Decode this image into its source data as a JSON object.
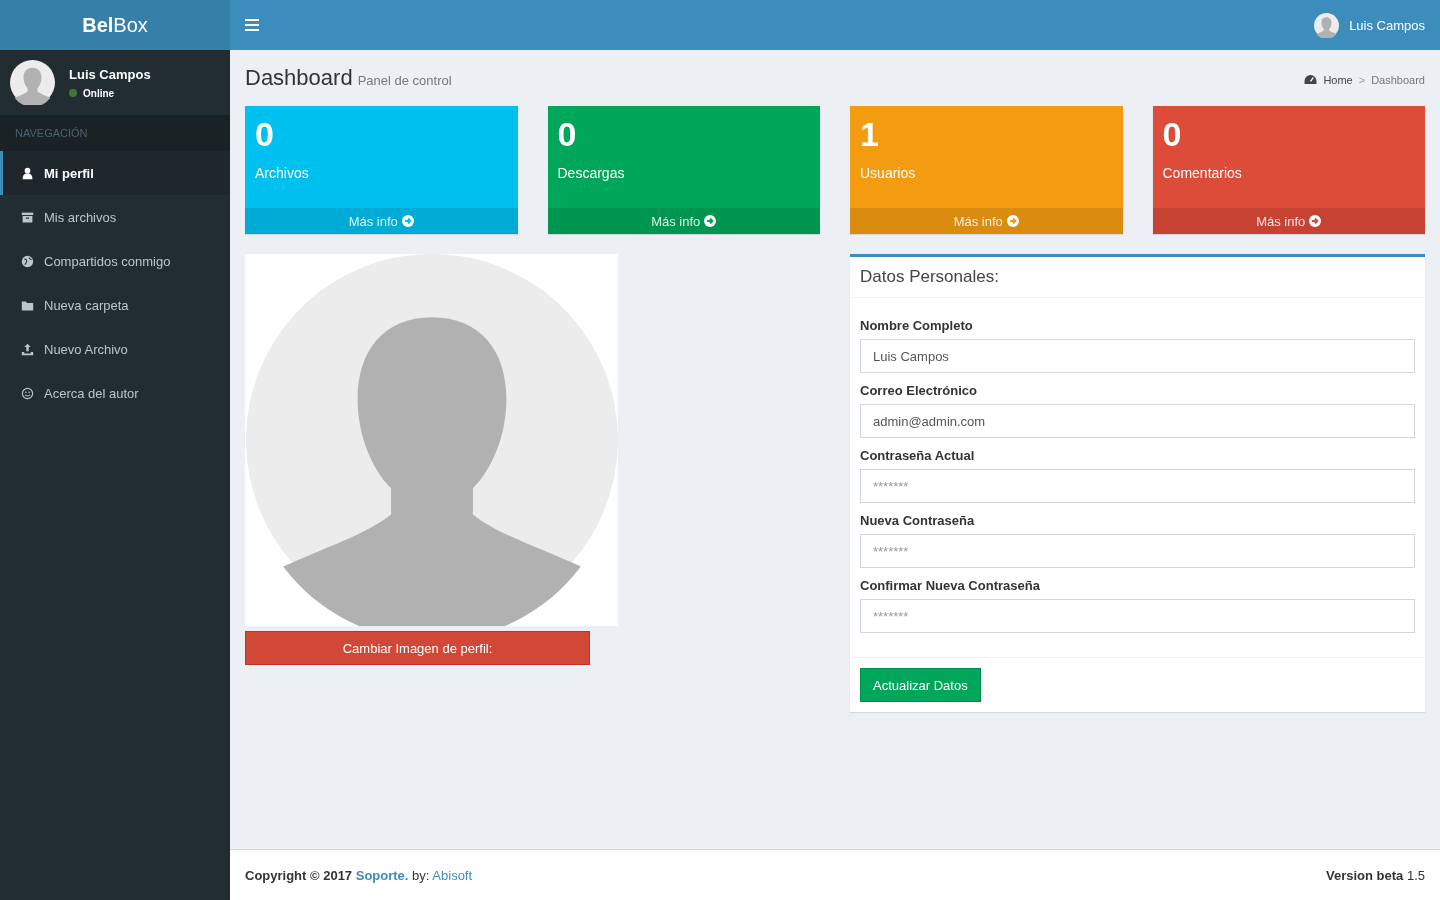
{
  "header": {
    "logo": "**Bel**Box",
    "user": "Luis Campos"
  },
  "sidebar": {
    "user": {
      "name": "Luis Campos",
      "status": "Online",
      "online": true
    },
    "section": "NAVEGACIÓN",
    "items": [
      {
        "label": "Mi perfil",
        "selected": true
      },
      {
        "label": "Mis archivos",
        "selected": false
      },
      {
        "label": "Compartidos conmigo",
        "selected": false
      },
      {
        "label": "Nueva carpeta",
        "selected": false
      },
      {
        "label": "Nuevo Archivo",
        "selected": false
      },
      {
        "label": "Acerca del autor",
        "selected": false
      }
    ]
  },
  "page": {
    "title": "Dashboard",
    "subtitle": "Panel de control",
    "breadcrumb": [
      {
        "label": "Home"
      },
      {
        "label": "Dashboard"
      }
    ],
    "breadcrumb_separator": ">"
  },
  "stats": [
    {
      "count": "0",
      "label": "Archivos",
      "link": "Más info",
      "color": "#00c0ef"
    },
    {
      "count": "0",
      "label": "Descargas",
      "link": "Más info",
      "color": "#00a65a"
    },
    {
      "count": "1",
      "label": "Usuarios",
      "link": "Más info",
      "color": "#f39c12"
    },
    {
      "count": "0",
      "label": "Comentarios",
      "link": "Más info",
      "color": "#dd4b39"
    }
  ],
  "profile_image": {
    "button": "Cambiar Imagen de perfil:"
  },
  "form": {
    "title": "Datos Personales:",
    "fields": [
      {
        "label": "Nombre Completo",
        "value": "Luis Campos"
      },
      {
        "label": "Correo Electrónico",
        "value": "admin@admin.com"
      },
      {
        "label": "Contraseña Actual",
        "placeholder": "*******"
      },
      {
        "label": "Nueva Contraseña",
        "placeholder": "*******"
      },
      {
        "label": "Confirmar Nueva Contraseña",
        "placeholder": "*******"
      }
    ],
    "submit": "Actualizar Datos"
  },
  "footer": {
    "copyright": "Copyright © 2017",
    "link": "Soporte.",
    "by": "by:",
    "author": "Abisoft",
    "version": "**Version beta** 1.5"
  }
}
